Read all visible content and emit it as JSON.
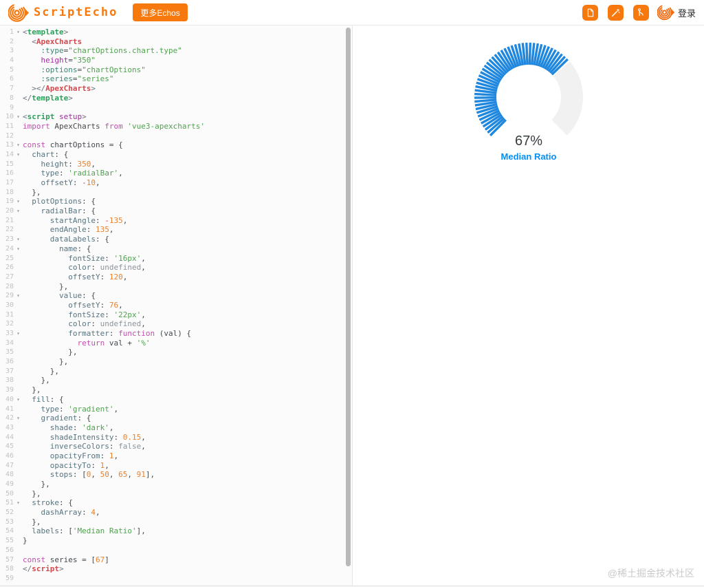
{
  "header": {
    "logo_text": "ScriptEcho",
    "more_button_label": "更多Echos",
    "login_label": "登录",
    "accent_color": "#f7790d"
  },
  "editor": {
    "lines": [
      {
        "n": 1,
        "f": 1,
        "t": [
          [
            "br",
            "<"
          ],
          [
            "tag",
            "template"
          ],
          [
            "br",
            ">"
          ]
        ]
      },
      {
        "n": 2,
        "t": [
          [
            "plain",
            "  "
          ],
          [
            "br",
            "<"
          ],
          [
            "comp",
            "ApexCharts"
          ]
        ]
      },
      {
        "n": 3,
        "t": [
          [
            "plain",
            "    "
          ],
          [
            "battr",
            ":type"
          ],
          [
            "plain",
            "="
          ],
          [
            "str",
            "\"chartOptions.chart.type\""
          ]
        ]
      },
      {
        "n": 4,
        "t": [
          [
            "plain",
            "    "
          ],
          [
            "attr",
            "height"
          ],
          [
            "plain",
            "="
          ],
          [
            "str",
            "\"350\""
          ]
        ]
      },
      {
        "n": 5,
        "t": [
          [
            "plain",
            "    "
          ],
          [
            "battr",
            ":options"
          ],
          [
            "plain",
            "="
          ],
          [
            "str",
            "\"chartOptions\""
          ]
        ]
      },
      {
        "n": 6,
        "t": [
          [
            "plain",
            "    "
          ],
          [
            "battr",
            ":series"
          ],
          [
            "plain",
            "="
          ],
          [
            "str",
            "\"series\""
          ]
        ]
      },
      {
        "n": 7,
        "t": [
          [
            "plain",
            "  "
          ],
          [
            "br",
            "></"
          ],
          [
            "comp",
            "ApexCharts"
          ],
          [
            "br",
            ">"
          ]
        ]
      },
      {
        "n": 8,
        "t": [
          [
            "br",
            "</"
          ],
          [
            "tag",
            "template"
          ],
          [
            "br",
            ">"
          ]
        ]
      },
      {
        "n": 9,
        "t": []
      },
      {
        "n": 10,
        "f": 1,
        "t": [
          [
            "br",
            "<"
          ],
          [
            "tag",
            "script"
          ],
          [
            "plain",
            " "
          ],
          [
            "attr",
            "setup"
          ],
          [
            "br",
            ">"
          ]
        ]
      },
      {
        "n": 11,
        "t": [
          [
            "kw",
            "import"
          ],
          [
            "plain",
            " ApexCharts "
          ],
          [
            "kw",
            "from"
          ],
          [
            "plain",
            " "
          ],
          [
            "str",
            "'vue3-apexcharts'"
          ]
        ]
      },
      {
        "n": 12,
        "t": []
      },
      {
        "n": 13,
        "f": 1,
        "t": [
          [
            "kw",
            "const"
          ],
          [
            "plain",
            " chartOptions = {"
          ]
        ]
      },
      {
        "n": 14,
        "f": 1,
        "t": [
          [
            "plain",
            "  "
          ],
          [
            "prop",
            "chart"
          ],
          [
            "plain",
            ": {"
          ]
        ]
      },
      {
        "n": 15,
        "t": [
          [
            "plain",
            "    "
          ],
          [
            "prop",
            "height"
          ],
          [
            "plain",
            ": "
          ],
          [
            "num",
            "350"
          ],
          [
            "plain",
            ","
          ]
        ]
      },
      {
        "n": 16,
        "t": [
          [
            "plain",
            "    "
          ],
          [
            "prop",
            "type"
          ],
          [
            "plain",
            ": "
          ],
          [
            "str",
            "'radialBar'"
          ],
          [
            "plain",
            ","
          ]
        ]
      },
      {
        "n": 17,
        "t": [
          [
            "plain",
            "    "
          ],
          [
            "prop",
            "offsetY"
          ],
          [
            "plain",
            ": "
          ],
          [
            "neg",
            "-"
          ],
          [
            "num",
            "10"
          ],
          [
            "plain",
            ","
          ]
        ]
      },
      {
        "n": 18,
        "t": [
          [
            "plain",
            "  },"
          ]
        ]
      },
      {
        "n": 19,
        "f": 1,
        "t": [
          [
            "plain",
            "  "
          ],
          [
            "prop",
            "plotOptions"
          ],
          [
            "plain",
            ": {"
          ]
        ]
      },
      {
        "n": 20,
        "f": 1,
        "t": [
          [
            "plain",
            "    "
          ],
          [
            "prop",
            "radialBar"
          ],
          [
            "plain",
            ": {"
          ]
        ]
      },
      {
        "n": 21,
        "t": [
          [
            "plain",
            "      "
          ],
          [
            "prop",
            "startAngle"
          ],
          [
            "plain",
            ": "
          ],
          [
            "neg",
            "-"
          ],
          [
            "num",
            "135"
          ],
          [
            "plain",
            ","
          ]
        ]
      },
      {
        "n": 22,
        "t": [
          [
            "plain",
            "      "
          ],
          [
            "prop",
            "endAngle"
          ],
          [
            "plain",
            ": "
          ],
          [
            "num",
            "135"
          ],
          [
            "plain",
            ","
          ]
        ]
      },
      {
        "n": 23,
        "f": 1,
        "t": [
          [
            "plain",
            "      "
          ],
          [
            "prop",
            "dataLabels"
          ],
          [
            "plain",
            ": {"
          ]
        ]
      },
      {
        "n": 24,
        "f": 1,
        "t": [
          [
            "plain",
            "        "
          ],
          [
            "prop",
            "name"
          ],
          [
            "plain",
            ": {"
          ]
        ]
      },
      {
        "n": 25,
        "t": [
          [
            "plain",
            "          "
          ],
          [
            "prop",
            "fontSize"
          ],
          [
            "plain",
            ": "
          ],
          [
            "str",
            "'16px'"
          ],
          [
            "plain",
            ","
          ]
        ]
      },
      {
        "n": 26,
        "t": [
          [
            "plain",
            "          "
          ],
          [
            "prop",
            "color"
          ],
          [
            "plain",
            ": "
          ],
          [
            "lit",
            "undefined"
          ],
          [
            "plain",
            ","
          ]
        ]
      },
      {
        "n": 27,
        "t": [
          [
            "plain",
            "          "
          ],
          [
            "prop",
            "offsetY"
          ],
          [
            "plain",
            ": "
          ],
          [
            "num",
            "120"
          ],
          [
            "plain",
            ","
          ]
        ]
      },
      {
        "n": 28,
        "t": [
          [
            "plain",
            "        },"
          ]
        ]
      },
      {
        "n": 29,
        "f": 1,
        "t": [
          [
            "plain",
            "        "
          ],
          [
            "prop",
            "value"
          ],
          [
            "plain",
            ": {"
          ]
        ]
      },
      {
        "n": 30,
        "t": [
          [
            "plain",
            "          "
          ],
          [
            "prop",
            "offsetY"
          ],
          [
            "plain",
            ": "
          ],
          [
            "num",
            "76"
          ],
          [
            "plain",
            ","
          ]
        ]
      },
      {
        "n": 31,
        "t": [
          [
            "plain",
            "          "
          ],
          [
            "prop",
            "fontSize"
          ],
          [
            "plain",
            ": "
          ],
          [
            "str",
            "'22px'"
          ],
          [
            "plain",
            ","
          ]
        ]
      },
      {
        "n": 32,
        "t": [
          [
            "plain",
            "          "
          ],
          [
            "prop",
            "color"
          ],
          [
            "plain",
            ": "
          ],
          [
            "lit",
            "undefined"
          ],
          [
            "plain",
            ","
          ]
        ]
      },
      {
        "n": 33,
        "f": 1,
        "t": [
          [
            "plain",
            "          "
          ],
          [
            "prop",
            "formatter"
          ],
          [
            "plain",
            ": "
          ],
          [
            "kw",
            "function"
          ],
          [
            "plain",
            " (val) {"
          ]
        ]
      },
      {
        "n": 34,
        "t": [
          [
            "plain",
            "            "
          ],
          [
            "kw",
            "return"
          ],
          [
            "plain",
            " val + "
          ],
          [
            "str",
            "'%'"
          ]
        ]
      },
      {
        "n": 35,
        "t": [
          [
            "plain",
            "          },"
          ]
        ]
      },
      {
        "n": 36,
        "t": [
          [
            "plain",
            "        },"
          ]
        ]
      },
      {
        "n": 37,
        "t": [
          [
            "plain",
            "      },"
          ]
        ]
      },
      {
        "n": 38,
        "t": [
          [
            "plain",
            "    },"
          ]
        ]
      },
      {
        "n": 39,
        "t": [
          [
            "plain",
            "  },"
          ]
        ]
      },
      {
        "n": 40,
        "f": 1,
        "t": [
          [
            "plain",
            "  "
          ],
          [
            "prop",
            "fill"
          ],
          [
            "plain",
            ": {"
          ]
        ]
      },
      {
        "n": 41,
        "t": [
          [
            "plain",
            "    "
          ],
          [
            "prop",
            "type"
          ],
          [
            "plain",
            ": "
          ],
          [
            "str",
            "'gradient'"
          ],
          [
            "plain",
            ","
          ]
        ]
      },
      {
        "n": 42,
        "f": 1,
        "t": [
          [
            "plain",
            "    "
          ],
          [
            "prop",
            "gradient"
          ],
          [
            "plain",
            ": {"
          ]
        ]
      },
      {
        "n": 43,
        "t": [
          [
            "plain",
            "      "
          ],
          [
            "prop",
            "shade"
          ],
          [
            "plain",
            ": "
          ],
          [
            "str",
            "'dark'"
          ],
          [
            "plain",
            ","
          ]
        ]
      },
      {
        "n": 44,
        "t": [
          [
            "plain",
            "      "
          ],
          [
            "prop",
            "shadeIntensity"
          ],
          [
            "plain",
            ": "
          ],
          [
            "num",
            "0.15"
          ],
          [
            "plain",
            ","
          ]
        ]
      },
      {
        "n": 45,
        "t": [
          [
            "plain",
            "      "
          ],
          [
            "prop",
            "inverseColors"
          ],
          [
            "plain",
            ": "
          ],
          [
            "lit",
            "false"
          ],
          [
            "plain",
            ","
          ]
        ]
      },
      {
        "n": 46,
        "t": [
          [
            "plain",
            "      "
          ],
          [
            "prop",
            "opacityFrom"
          ],
          [
            "plain",
            ": "
          ],
          [
            "num",
            "1"
          ],
          [
            "plain",
            ","
          ]
        ]
      },
      {
        "n": 47,
        "t": [
          [
            "plain",
            "      "
          ],
          [
            "prop",
            "opacityTo"
          ],
          [
            "plain",
            ": "
          ],
          [
            "num",
            "1"
          ],
          [
            "plain",
            ","
          ]
        ]
      },
      {
        "n": 48,
        "t": [
          [
            "plain",
            "      "
          ],
          [
            "prop",
            "stops"
          ],
          [
            "plain",
            ": ["
          ],
          [
            "num",
            "0"
          ],
          [
            "plain",
            ", "
          ],
          [
            "num",
            "50"
          ],
          [
            "plain",
            ", "
          ],
          [
            "num",
            "65"
          ],
          [
            "plain",
            ", "
          ],
          [
            "num",
            "91"
          ],
          [
            "plain",
            "],"
          ]
        ]
      },
      {
        "n": 49,
        "t": [
          [
            "plain",
            "    },"
          ]
        ]
      },
      {
        "n": 50,
        "t": [
          [
            "plain",
            "  },"
          ]
        ]
      },
      {
        "n": 51,
        "f": 1,
        "t": [
          [
            "plain",
            "  "
          ],
          [
            "prop",
            "stroke"
          ],
          [
            "plain",
            ": {"
          ]
        ]
      },
      {
        "n": 52,
        "t": [
          [
            "plain",
            "    "
          ],
          [
            "prop",
            "dashArray"
          ],
          [
            "plain",
            ": "
          ],
          [
            "num",
            "4"
          ],
          [
            "plain",
            ","
          ]
        ]
      },
      {
        "n": 53,
        "t": [
          [
            "plain",
            "  },"
          ]
        ]
      },
      {
        "n": 54,
        "t": [
          [
            "plain",
            "  "
          ],
          [
            "prop",
            "labels"
          ],
          [
            "plain",
            ": ["
          ],
          [
            "str",
            "'Median Ratio'"
          ],
          [
            "plain",
            "],"
          ]
        ]
      },
      {
        "n": 55,
        "t": [
          [
            "plain",
            "}"
          ]
        ]
      },
      {
        "n": 56,
        "t": []
      },
      {
        "n": 57,
        "t": [
          [
            "kw",
            "const"
          ],
          [
            "plain",
            " series = ["
          ],
          [
            "num",
            "67"
          ],
          [
            "plain",
            "]"
          ]
        ]
      },
      {
        "n": 58,
        "t": [
          [
            "br",
            "</"
          ],
          [
            "comp",
            "script"
          ],
          [
            "br",
            ">"
          ]
        ]
      },
      {
        "n": 59,
        "t": []
      }
    ]
  },
  "chart_data": {
    "type": "radialBar",
    "series": [
      67
    ],
    "labels": [
      "Median Ratio"
    ],
    "value_text": "67%",
    "start_angle": -135,
    "end_angle": 135,
    "total_sweep_deg": 270,
    "dash_count": 46,
    "bar_color": "#1f87de",
    "track_color": "#f1f1f2",
    "value_color": "#373d3f",
    "label_color": "#008ffb"
  },
  "preview": {
    "watermark": "@稀土掘金技术社区"
  }
}
